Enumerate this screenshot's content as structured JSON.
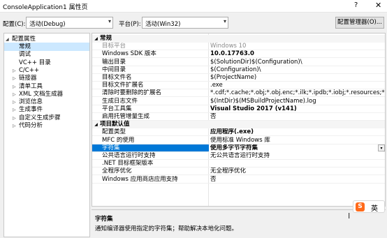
{
  "window": {
    "title": "ConsoleApplication1 属性页",
    "help_icon": "?",
    "close_icon": "✕"
  },
  "toolbar": {
    "config_label": "配置(C):",
    "config_value": "活动(Debug)",
    "platform_label": "平台(P):",
    "platform_value": "活动(Win32)",
    "config_manager_button": "配置管理器(O)..."
  },
  "tree": {
    "items": [
      {
        "label": "配置属性",
        "expanded": true,
        "has_children": true,
        "level": 0
      },
      {
        "label": "常规",
        "level": 1,
        "selected": true
      },
      {
        "label": "调试",
        "level": 1
      },
      {
        "label": "VC++ 目录",
        "level": 1
      },
      {
        "label": "C/C++",
        "level": 1,
        "has_children": true
      },
      {
        "label": "链接器",
        "level": 1,
        "has_children": true
      },
      {
        "label": "清单工具",
        "level": 1,
        "has_children": true
      },
      {
        "label": "XML 文档生成器",
        "level": 1,
        "has_children": true
      },
      {
        "label": "浏览信息",
        "level": 1,
        "has_children": true
      },
      {
        "label": "生成事件",
        "level": 1,
        "has_children": true
      },
      {
        "label": "自定义生成步骤",
        "level": 1,
        "has_children": true
      },
      {
        "label": "代码分析",
        "level": 1,
        "has_children": true
      }
    ]
  },
  "grid": {
    "categories": [
      {
        "label": "常规",
        "rows": [
          {
            "name": "目标平台",
            "value": "Windows 10",
            "gray": true
          },
          {
            "name": "Windows SDK 版本",
            "value": "10.0.17763.0",
            "bold": true
          },
          {
            "name": "输出目录",
            "value": "$(SolutionDir)$(Configuration)\\"
          },
          {
            "name": "中间目录",
            "value": "$(Configuration)\\"
          },
          {
            "name": "目标文件名",
            "value": "$(ProjectName)"
          },
          {
            "name": "目标文件扩展名",
            "value": ".exe"
          },
          {
            "name": "清除时要删除的扩展名",
            "value": "*.cdf;*.cache;*.obj;*.obj.enc;*.ilk;*.ipdb;*.iobj;*.resources;*.tlb;*.tli;*"
          },
          {
            "name": "生成日志文件",
            "value": "$(IntDir)$(MSBuildProjectName).log"
          },
          {
            "name": "平台工具集",
            "value": "Visual Studio 2017 (v141)",
            "bold": true
          },
          {
            "name": "启用托管增量生成",
            "value": "否"
          }
        ]
      },
      {
        "label": "项目默认值",
        "rows": [
          {
            "name": "配置类型",
            "value": "应用程序(.exe)",
            "bold": true
          },
          {
            "name": "MFC 的使用",
            "value": "使用标准 Windows 库"
          },
          {
            "name": "字符集",
            "value": "使用多字节字符集",
            "bold": true,
            "selected": true
          },
          {
            "name": "公共语言运行时支持",
            "value": "无公共语言运行时支持"
          },
          {
            "name": ".NET 目标框架版本",
            "value": ""
          },
          {
            "name": "全程序优化",
            "value": "无全程序优化"
          },
          {
            "name": "Windows 应用商店应用支持",
            "value": "否"
          }
        ]
      }
    ]
  },
  "description": {
    "title": "字符集",
    "text": "通知编译器使用指定的字符集；帮助解决本地化问题。"
  },
  "ime": {
    "logo": "S",
    "mode": "英"
  },
  "icons": {
    "dropdown": "▾",
    "expanded": "◢",
    "collapsed": "▷"
  }
}
